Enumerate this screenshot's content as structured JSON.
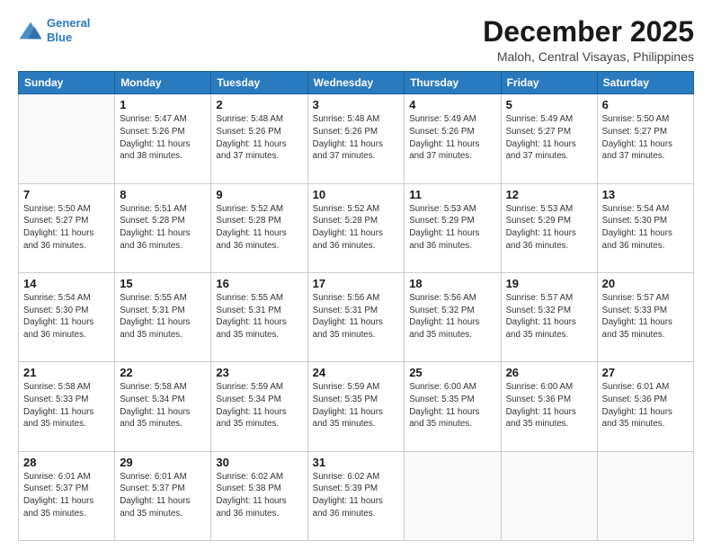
{
  "header": {
    "logo_line1": "General",
    "logo_line2": "Blue",
    "main_title": "December 2025",
    "subtitle": "Maloh, Central Visayas, Philippines"
  },
  "days_of_week": [
    "Sunday",
    "Monday",
    "Tuesday",
    "Wednesday",
    "Thursday",
    "Friday",
    "Saturday"
  ],
  "weeks": [
    [
      {
        "day": "",
        "info": ""
      },
      {
        "day": "1",
        "info": "Sunrise: 5:47 AM\nSunset: 5:26 PM\nDaylight: 11 hours\nand 38 minutes."
      },
      {
        "day": "2",
        "info": "Sunrise: 5:48 AM\nSunset: 5:26 PM\nDaylight: 11 hours\nand 37 minutes."
      },
      {
        "day": "3",
        "info": "Sunrise: 5:48 AM\nSunset: 5:26 PM\nDaylight: 11 hours\nand 37 minutes."
      },
      {
        "day": "4",
        "info": "Sunrise: 5:49 AM\nSunset: 5:26 PM\nDaylight: 11 hours\nand 37 minutes."
      },
      {
        "day": "5",
        "info": "Sunrise: 5:49 AM\nSunset: 5:27 PM\nDaylight: 11 hours\nand 37 minutes."
      },
      {
        "day": "6",
        "info": "Sunrise: 5:50 AM\nSunset: 5:27 PM\nDaylight: 11 hours\nand 37 minutes."
      }
    ],
    [
      {
        "day": "7",
        "info": "Sunrise: 5:50 AM\nSunset: 5:27 PM\nDaylight: 11 hours\nand 36 minutes."
      },
      {
        "day": "8",
        "info": "Sunrise: 5:51 AM\nSunset: 5:28 PM\nDaylight: 11 hours\nand 36 minutes."
      },
      {
        "day": "9",
        "info": "Sunrise: 5:52 AM\nSunset: 5:28 PM\nDaylight: 11 hours\nand 36 minutes."
      },
      {
        "day": "10",
        "info": "Sunrise: 5:52 AM\nSunset: 5:28 PM\nDaylight: 11 hours\nand 36 minutes."
      },
      {
        "day": "11",
        "info": "Sunrise: 5:53 AM\nSunset: 5:29 PM\nDaylight: 11 hours\nand 36 minutes."
      },
      {
        "day": "12",
        "info": "Sunrise: 5:53 AM\nSunset: 5:29 PM\nDaylight: 11 hours\nand 36 minutes."
      },
      {
        "day": "13",
        "info": "Sunrise: 5:54 AM\nSunset: 5:30 PM\nDaylight: 11 hours\nand 36 minutes."
      }
    ],
    [
      {
        "day": "14",
        "info": "Sunrise: 5:54 AM\nSunset: 5:30 PM\nDaylight: 11 hours\nand 36 minutes."
      },
      {
        "day": "15",
        "info": "Sunrise: 5:55 AM\nSunset: 5:31 PM\nDaylight: 11 hours\nand 35 minutes."
      },
      {
        "day": "16",
        "info": "Sunrise: 5:55 AM\nSunset: 5:31 PM\nDaylight: 11 hours\nand 35 minutes."
      },
      {
        "day": "17",
        "info": "Sunrise: 5:56 AM\nSunset: 5:31 PM\nDaylight: 11 hours\nand 35 minutes."
      },
      {
        "day": "18",
        "info": "Sunrise: 5:56 AM\nSunset: 5:32 PM\nDaylight: 11 hours\nand 35 minutes."
      },
      {
        "day": "19",
        "info": "Sunrise: 5:57 AM\nSunset: 5:32 PM\nDaylight: 11 hours\nand 35 minutes."
      },
      {
        "day": "20",
        "info": "Sunrise: 5:57 AM\nSunset: 5:33 PM\nDaylight: 11 hours\nand 35 minutes."
      }
    ],
    [
      {
        "day": "21",
        "info": "Sunrise: 5:58 AM\nSunset: 5:33 PM\nDaylight: 11 hours\nand 35 minutes."
      },
      {
        "day": "22",
        "info": "Sunrise: 5:58 AM\nSunset: 5:34 PM\nDaylight: 11 hours\nand 35 minutes."
      },
      {
        "day": "23",
        "info": "Sunrise: 5:59 AM\nSunset: 5:34 PM\nDaylight: 11 hours\nand 35 minutes."
      },
      {
        "day": "24",
        "info": "Sunrise: 5:59 AM\nSunset: 5:35 PM\nDaylight: 11 hours\nand 35 minutes."
      },
      {
        "day": "25",
        "info": "Sunrise: 6:00 AM\nSunset: 5:35 PM\nDaylight: 11 hours\nand 35 minutes."
      },
      {
        "day": "26",
        "info": "Sunrise: 6:00 AM\nSunset: 5:36 PM\nDaylight: 11 hours\nand 35 minutes."
      },
      {
        "day": "27",
        "info": "Sunrise: 6:01 AM\nSunset: 5:36 PM\nDaylight: 11 hours\nand 35 minutes."
      }
    ],
    [
      {
        "day": "28",
        "info": "Sunrise: 6:01 AM\nSunset: 5:37 PM\nDaylight: 11 hours\nand 35 minutes."
      },
      {
        "day": "29",
        "info": "Sunrise: 6:01 AM\nSunset: 5:37 PM\nDaylight: 11 hours\nand 35 minutes."
      },
      {
        "day": "30",
        "info": "Sunrise: 6:02 AM\nSunset: 5:38 PM\nDaylight: 11 hours\nand 36 minutes."
      },
      {
        "day": "31",
        "info": "Sunrise: 6:02 AM\nSunset: 5:39 PM\nDaylight: 11 hours\nand 36 minutes."
      },
      {
        "day": "",
        "info": ""
      },
      {
        "day": "",
        "info": ""
      },
      {
        "day": "",
        "info": ""
      }
    ]
  ]
}
